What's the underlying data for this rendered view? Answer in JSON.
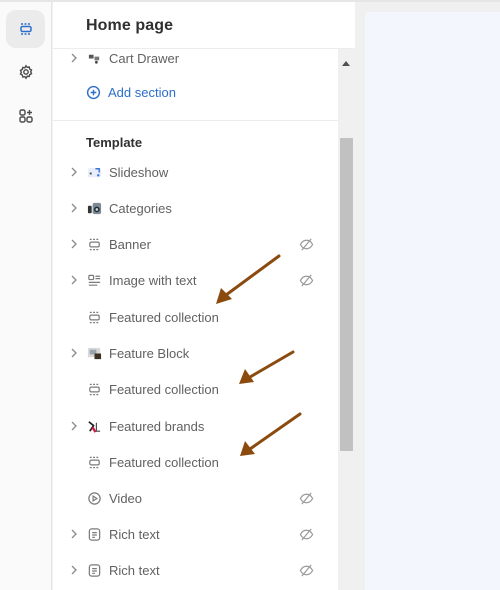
{
  "rail": {
    "items": [
      {
        "name": "sections",
        "icon": "sections-icon",
        "active": true
      },
      {
        "name": "theme-settings",
        "icon": "gear-icon",
        "active": false
      },
      {
        "name": "apps",
        "icon": "apps-add-icon",
        "active": false
      }
    ]
  },
  "panel": {
    "title": "Home page",
    "header_group": {
      "items": [
        {
          "label": "Cart Drawer",
          "icon": "cart-drawer-icon",
          "expandable": true,
          "hidden": false
        }
      ],
      "add_section_label": "Add section"
    },
    "template": {
      "heading": "Template",
      "items": [
        {
          "label": "Slideshow",
          "icon": "slideshow-icon",
          "expandable": true,
          "hidden": false
        },
        {
          "label": "Categories",
          "icon": "categories-icon",
          "expandable": true,
          "hidden": false
        },
        {
          "label": "Banner",
          "icon": "section-icon",
          "expandable": true,
          "hidden": true
        },
        {
          "label": "Image with text",
          "icon": "image-with-text-icon",
          "expandable": true,
          "hidden": true
        },
        {
          "label": "Featured collection",
          "icon": "section-icon",
          "expandable": false,
          "hidden": false,
          "annotated": true
        },
        {
          "label": "Feature Block",
          "icon": "feature-block-icon",
          "expandable": true,
          "hidden": false
        },
        {
          "label": "Featured collection",
          "icon": "section-icon",
          "expandable": false,
          "hidden": false,
          "annotated": true
        },
        {
          "label": "Featured brands",
          "icon": "featured-brands-icon",
          "expandable": true,
          "hidden": false
        },
        {
          "label": "Featured collection",
          "icon": "section-icon",
          "expandable": false,
          "hidden": false,
          "annotated": true
        },
        {
          "label": "Video",
          "icon": "video-icon",
          "expandable": false,
          "hidden": true
        },
        {
          "label": "Rich text",
          "icon": "rich-text-icon",
          "expandable": true,
          "hidden": true
        },
        {
          "label": "Rich text",
          "icon": "rich-text-icon",
          "expandable": true,
          "hidden": true
        }
      ]
    }
  },
  "colors": {
    "accent": "#2c6ecb",
    "annotation_arrow": "#8b4a0e",
    "preview_bg": "#f4f6fe"
  }
}
